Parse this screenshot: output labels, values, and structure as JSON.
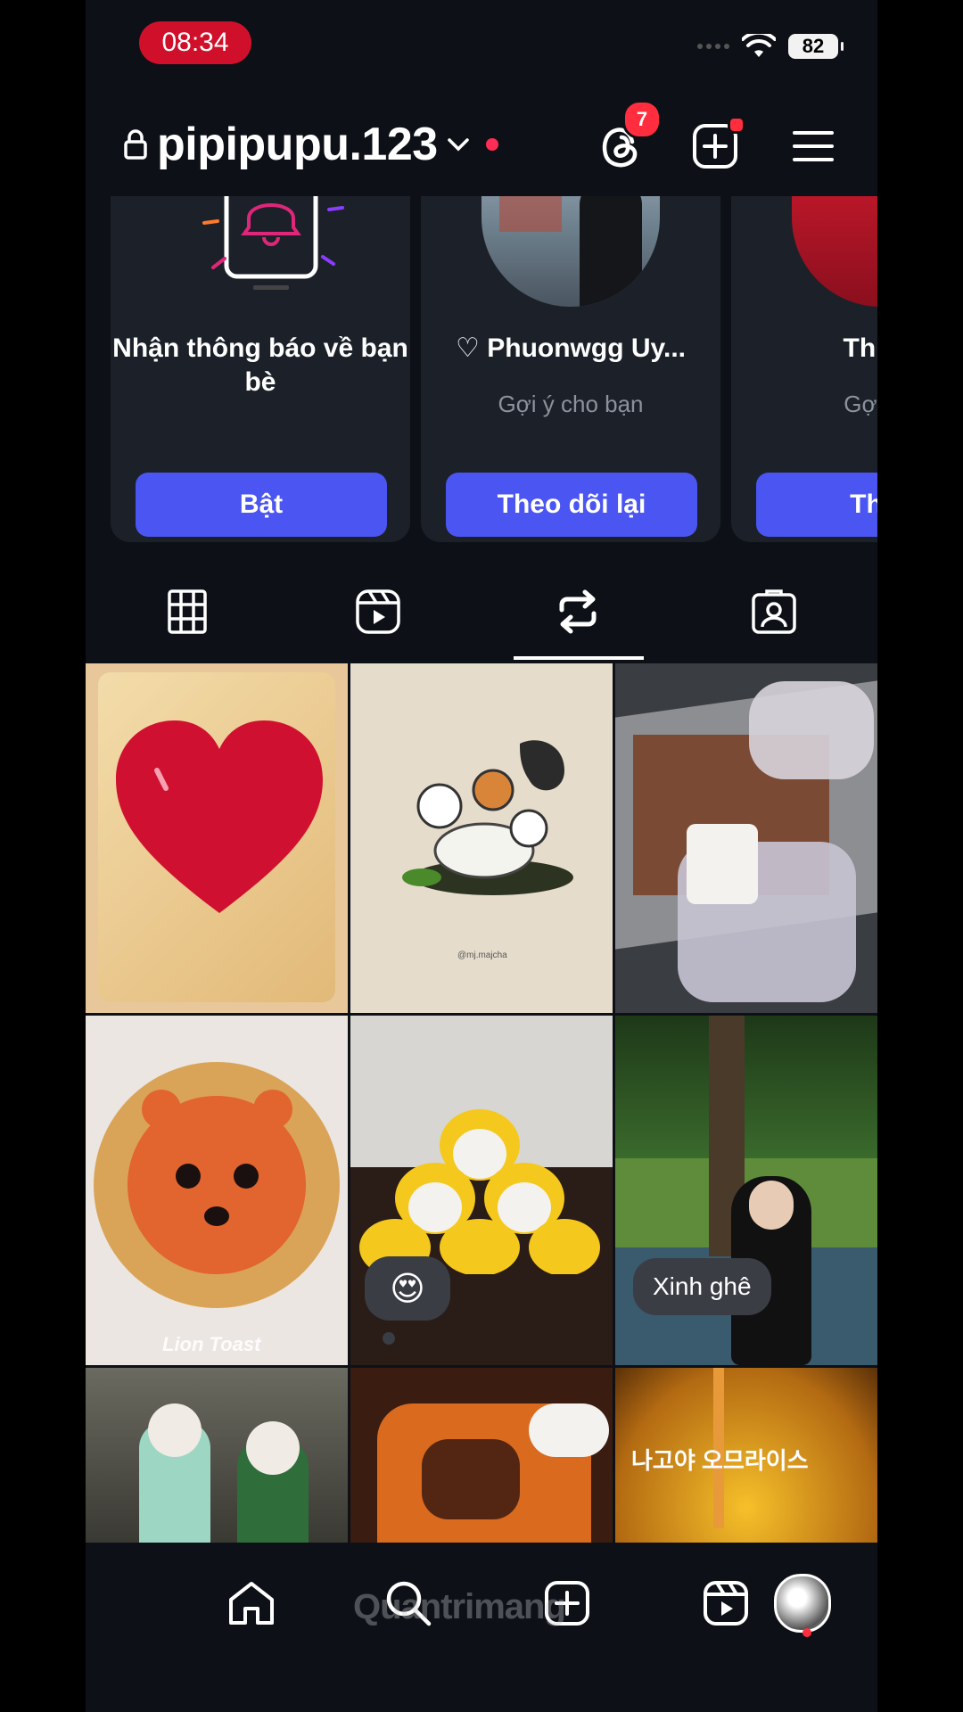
{
  "status_bar": {
    "time": "08:34",
    "battery": "82"
  },
  "header": {
    "username": "pipipupu.123",
    "threads_badge": "7"
  },
  "suggestions": [
    {
      "name": "Nhận thông báo về bạn bè",
      "subtitle": "",
      "button": "Bật"
    },
    {
      "name": "♡ Phuonwgg Uy...",
      "subtitle": "Gợi ý cho bạn",
      "button": "Theo dõi lại"
    },
    {
      "name": "Thu H",
      "subtitle": "Gợi ý c",
      "button": "Theo"
    }
  ],
  "tabs": [
    {
      "icon": "grid-icon",
      "active": false
    },
    {
      "icon": "reels-icon",
      "active": false
    },
    {
      "icon": "reposts-icon",
      "active": true
    },
    {
      "icon": "tagged-icon",
      "active": false
    }
  ],
  "grid": {
    "captions": {
      "lion_toast": "Lion Toast",
      "emoji": "😍",
      "comment": "Xinh ghê",
      "korean": "나고야 오므라이스",
      "watermark_small": "@mj.majcha"
    }
  },
  "bottom_nav": {
    "items": [
      "home-icon",
      "search-icon",
      "create-icon",
      "reels-icon",
      "profile-avatar"
    ],
    "watermark": "Quantrimang"
  },
  "colors": {
    "background": "#0d1117",
    "card": "#1c2129",
    "button": "#4a55f2",
    "badge": "#ff2d3d",
    "time_pill": "#d0102a"
  }
}
